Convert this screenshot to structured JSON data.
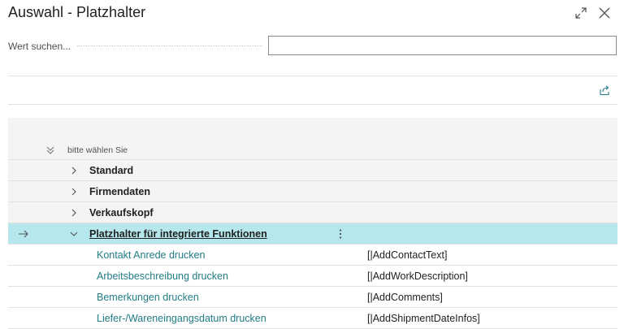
{
  "dialog": {
    "title": "Auswahl - Platzhalter"
  },
  "search": {
    "label": "Wert suchen...",
    "value": ""
  },
  "list": {
    "header_label": "bitte wählen Sie",
    "groups": [
      {
        "label": "Standard"
      },
      {
        "label": "Firmendaten"
      },
      {
        "label": "Verkaufskopf"
      },
      {
        "label": "Platzhalter für integrierte Funktionen"
      }
    ],
    "items": [
      {
        "label": "Kontakt Anrede drucken",
        "code": "[|AddContactText]"
      },
      {
        "label": "Arbeitsbeschreibung drucken",
        "code": "[|AddWorkDescription]"
      },
      {
        "label": "Bemerkungen drucken",
        "code": "[|AddComments]"
      },
      {
        "label": "Liefer-/Wareneingangsdatum drucken",
        "code": "[|AddShipmentDateInfos]"
      }
    ]
  },
  "icons": {
    "expand": "expand-icon",
    "close": "close-icon",
    "share": "share-icon",
    "collapse_all": "double-chevron-down-icon",
    "row_arrow": "arrow-right-icon",
    "more": "more-vertical-icon",
    "chevron_right": "chevron-right-icon",
    "chevron_down": "chevron-down-icon"
  },
  "colors": {
    "accent": "#217c84",
    "selected_row": "#b5e7ec",
    "group_bg": "#f4f4f4"
  }
}
